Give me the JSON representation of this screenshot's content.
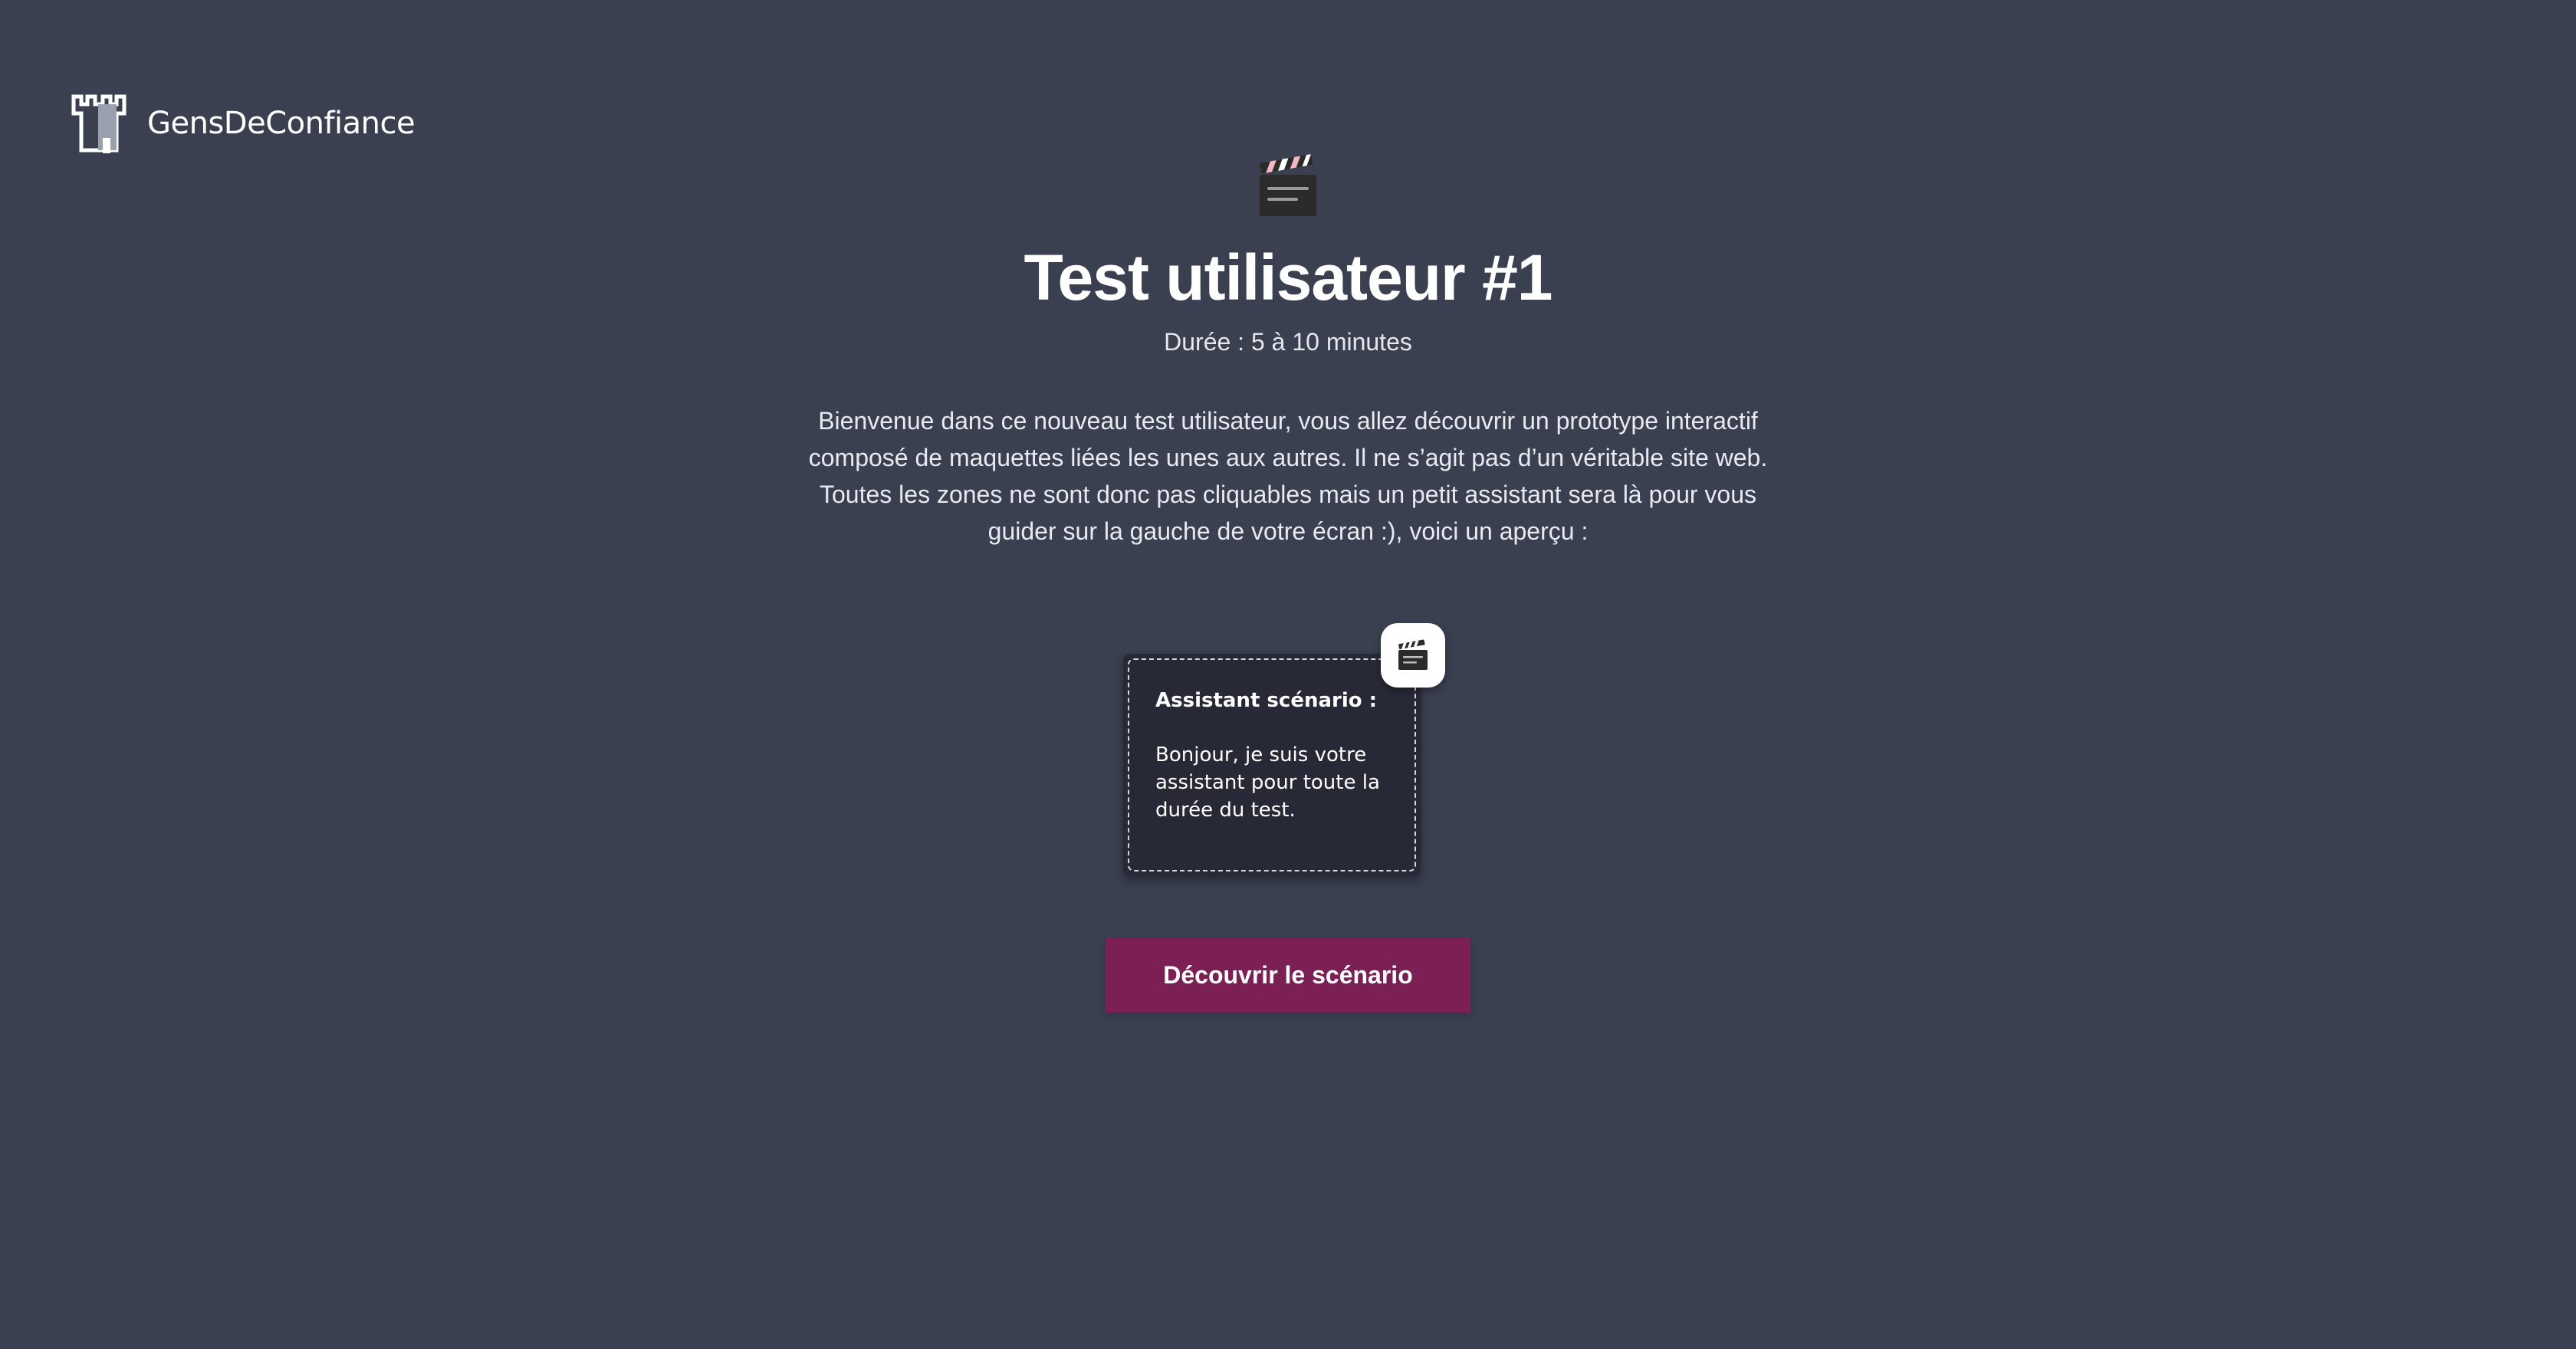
{
  "brand": {
    "name": "GensDeConfiance",
    "logo_icon": "castle-tower-icon"
  },
  "hero": {
    "icon": "clapperboard-icon",
    "title": "Test utilisateur #1",
    "duration": "Durée : 5 à 10 minutes"
  },
  "intro": {
    "lines": [
      "Bienvenue dans ce nouveau test utilisateur, vous allez découvrir un prototype interactif",
      "composé de maquettes liées les unes aux autres. Il ne s’agit pas d’un véritable site web.",
      "Toutes les zones ne sont donc pas cliquables mais un petit assistant sera là pour vous",
      "guider sur la gauche de votre écran :), voici un aperçu :"
    ]
  },
  "assistant_preview": {
    "badge_icon": "clapperboard-icon",
    "heading": "Assistant scénario :",
    "body": "Bonjour, je suis votre assistant pour toute la durée du test."
  },
  "cta": {
    "label": "Découvrir le scénario"
  },
  "colors": {
    "background": "#3b4050",
    "card": "#272a36",
    "cta": "#7b1f54",
    "text": "#ffffff"
  }
}
